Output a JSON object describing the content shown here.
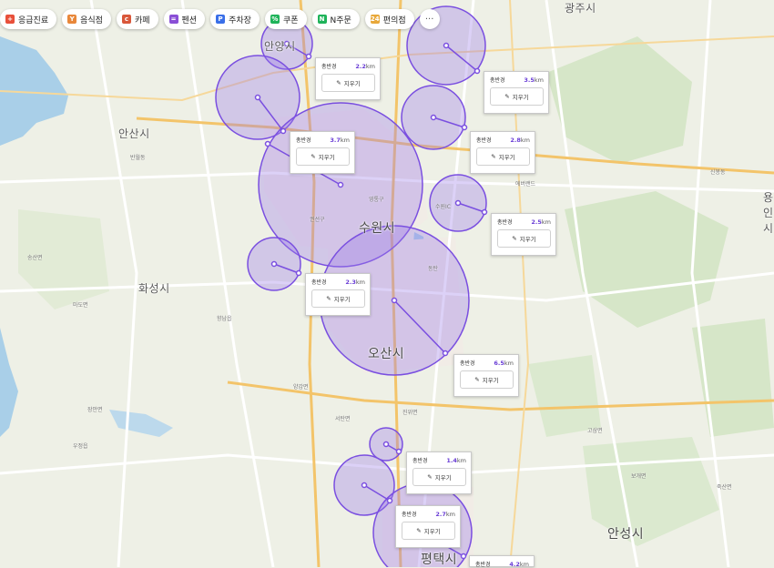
{
  "categories": [
    {
      "label": "응급진료",
      "icon": "emergency-icon",
      "color": "#e8503a"
    },
    {
      "label": "음식점",
      "icon": "restaurant-icon",
      "color": "#e8873a"
    },
    {
      "label": "카페",
      "icon": "cafe-icon",
      "color": "#d9573a"
    },
    {
      "label": "펜션",
      "icon": "bed-icon",
      "color": "#8a4fd6"
    },
    {
      "label": "주차장",
      "icon": "parking-icon",
      "color": "#3a6fe8"
    },
    {
      "label": "쿠폰",
      "icon": "coupon-icon",
      "color": "#1fb35a"
    },
    {
      "label": "N주문",
      "icon": "order-icon",
      "color": "#1fb35a"
    },
    {
      "label": "편의점",
      "icon": "store-icon",
      "color": "#e8a83a"
    }
  ],
  "more_label": "···",
  "cities": [
    {
      "name": "안양시"
    },
    {
      "name": "안산시"
    },
    {
      "name": "수원시"
    },
    {
      "name": "화성시"
    },
    {
      "name": "오산시"
    },
    {
      "name": "평택시"
    },
    {
      "name": "안성시"
    },
    {
      "name": "용인시"
    },
    {
      "name": "광주시"
    }
  ],
  "districts": [
    {
      "name": "반월동"
    },
    {
      "name": "권선구"
    },
    {
      "name": "영통구"
    },
    {
      "name": "수원IC"
    },
    {
      "name": "동탄"
    },
    {
      "name": "고삼면"
    },
    {
      "name": "보개면"
    },
    {
      "name": "죽산면"
    },
    {
      "name": "양감면"
    },
    {
      "name": "서탄면"
    },
    {
      "name": "진위면"
    },
    {
      "name": "송산면"
    },
    {
      "name": "마도면"
    },
    {
      "name": "우정읍"
    },
    {
      "name": "장안면"
    },
    {
      "name": "향남읍"
    },
    {
      "name": "에버랜드"
    },
    {
      "name": "신봉동"
    }
  ],
  "radius_label": "총반경",
  "erase_label": "지우기",
  "radii": [
    {
      "value": "2.2",
      "unit": "km"
    },
    {
      "value": "3.5",
      "unit": "km"
    },
    {
      "value": "2.8",
      "unit": "km"
    },
    {
      "value": "3.7",
      "unit": "km"
    },
    {
      "value": "2.5",
      "unit": "km"
    },
    {
      "value": "2.3",
      "unit": "km"
    },
    {
      "value": "6.5",
      "unit": "km"
    },
    {
      "value": "1.4",
      "unit": "km"
    },
    {
      "value": "2.7",
      "unit": "km"
    },
    {
      "value": "4.2",
      "unit": "km"
    }
  ],
  "colors": {
    "circle_fill": "#9a7ae8",
    "circle_stroke": "#7a4fe0",
    "water": "#a9cfe8",
    "land": "#eef0e6",
    "forest": "#d6e6c8",
    "road": "#ffffff",
    "highway": "#f3c46a"
  }
}
